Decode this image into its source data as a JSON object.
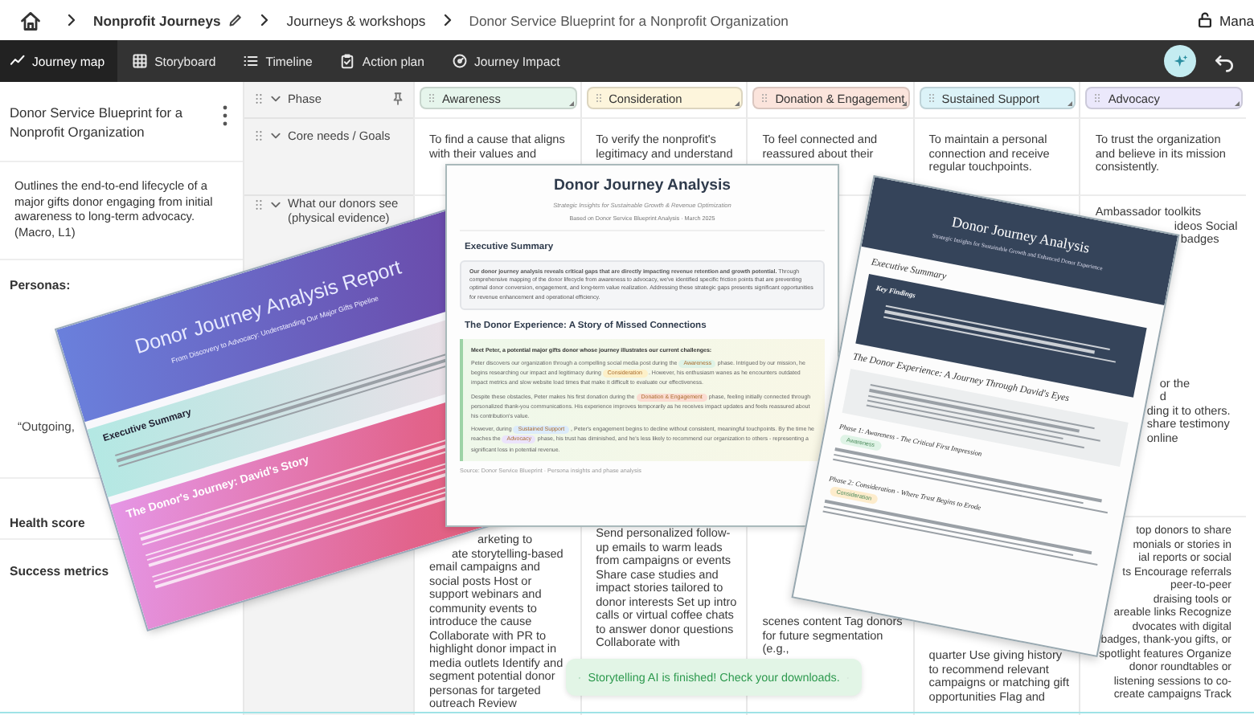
{
  "breadcrumbs": [
    "Nonprofit Journeys",
    "Journeys & workshops",
    "Donor Service Blueprint for a Nonprofit Organization"
  ],
  "account": {
    "label": "Mana"
  },
  "tabs": [
    {
      "label": "Journey map",
      "selected": true
    },
    {
      "label": "Storyboard",
      "selected": false
    },
    {
      "label": "Timeline",
      "selected": false
    },
    {
      "label": "Action plan",
      "selected": false
    },
    {
      "label": "Journey Impact",
      "selected": false
    }
  ],
  "journey": {
    "title": "Donor Service Blueprint for a Nonprofit Organization",
    "description": "Outlines the end-to-end lifecycle of a major gifts donor engaging from initial awareness to long-term advocacy. (Macro, L1)"
  },
  "sidebar_sections": [
    {
      "label": "Personas:",
      "quote": "“Outgoing,"
    },
    {
      "label": "Health score"
    },
    {
      "label": "Success metrics"
    }
  ],
  "row_labels": [
    "Phase",
    "Core needs / Goals",
    "What our donors see (physical evidence)"
  ],
  "phases": [
    {
      "label": "Awareness",
      "color": "#e6f5ec",
      "need": "To find a cause that aligns with their values and",
      "action_fragments": [
        "arketing to",
        "ate storytelling-based"
      ],
      "actions": "email campaigns and social posts Host or support webinars and community events to introduce the cause Collaborate with PR to highlight donor impact in media outlets Identify and segment potential donor personas for targeted outreach Review"
    },
    {
      "label": "Consideration",
      "color": "#fdf5dc",
      "need": "To verify the nonprofit's legitimacy and understand",
      "actions": "Send personalized follow-up emails to warm leads from campaigns or events Share case studies and impact stories tailored to donor interests Set up intro calls or virtual coffee chats to answer donor questions Collaborate with"
    },
    {
      "label": "Donation & Engagement",
      "color": "#fbe4dc",
      "need": "To feel connected and reassured about their",
      "actions": "scenes content Tag donors for future segmentation (e.g.,"
    },
    {
      "label": "Sustained Support",
      "color": "#dcf3f8",
      "need": "To maintain a personal connection and receive regular touchpoints.",
      "actions": "quarter Use giving history to recommend relevant campaigns or matching gift opportunities Flag and"
    },
    {
      "label": "Advocacy",
      "color": "#ebe8fb",
      "need": "To trust the organization and believe in its mission consistently.",
      "evidence_fragments": [
        "Ambassador toolkits",
        "ideos Social",
        "badges",
        "or the",
        "d",
        "ding it to others.",
        "share testimony",
        "online"
      ],
      "action_fragments": [
        "top donors to share",
        "monials or stories in",
        "ial reports or social",
        "ts Encourage referrals",
        "peer-to-peer",
        "draising tools or",
        "areable links Recognize",
        "dvocates with digital",
        "badges, thank-you gifts, or",
        "spotlight features Organize",
        "donor roundtables or",
        "listening sessions to co-",
        "create campaigns Track"
      ]
    }
  ],
  "report_gradient": {
    "title": "Donor Journey Analysis Report",
    "subtitle": "From Discovery to Advocacy: Understanding Our Major Gifts Pipeline",
    "summary_heading": "Executive Summary",
    "story_heading": "The Donor's Journey: David's Story"
  },
  "report_plain": {
    "title": "Donor Journey Analysis",
    "subtitle": "Strategic Insights for Sustainable Growth & Revenue Optimization",
    "based_on": "Based on Donor Service Blueprint Analysis · March 2025",
    "summary_heading": "Executive Summary",
    "summary": "**Our donor journey analysis reveals critical gaps that are directly impacting revenue retention and growth potential.** Through comprehensive mapping of the donor lifecycle from awareness to advocacy, we've identified specific friction points that are preventing optimal donor conversion, engagement, and long-term value realization. Addressing these strategic gaps presents significant opportunities for revenue enhancement and operational efficiency.",
    "story_heading": "The Donor Experience: A Story of Missed Connections",
    "story": [
      {
        "kind": "lead",
        "segments": [
          {
            "kind": "text",
            "text": "Meet Peter, a potential major gifts donor whose journey illustrates our current challenges:"
          }
        ]
      },
      {
        "kind": "body",
        "segments": [
          {
            "kind": "text",
            "text": "Peter discovers our organization through a compelling social media post during the"
          },
          {
            "kind": "tag",
            "text": "Awareness",
            "color": "#dff3e6"
          },
          {
            "kind": "text",
            "text": "phase. Intrigued by our mission, he begins researching our impact and legitimacy during"
          },
          {
            "kind": "tag",
            "text": "Consideration",
            "color": "#fdf0c8"
          },
          {
            "kind": "text",
            "text": ". However, his enthusiasm wanes as he encounters outdated impact metrics and slow website load times that make it difficult to evaluate our effectiveness."
          }
        ]
      },
      {
        "kind": "body",
        "segments": [
          {
            "kind": "text",
            "text": "Despite these obstacles, Peter makes his first donation during the"
          },
          {
            "kind": "tag",
            "text": "Donation & Engagement",
            "color": "#fbdcd2"
          },
          {
            "kind": "text",
            "text": "phase, feeling initially connected through personalized thank-you communications. His experience improves temporarily as he receives impact updates and feels reassured about his contribution's value."
          }
        ]
      },
      {
        "kind": "body",
        "segments": [
          {
            "kind": "text",
            "text": "However, during"
          },
          {
            "kind": "tag",
            "text": "Sustained Support",
            "color": "#dcebfb"
          },
          {
            "kind": "text",
            "text": ", Peter's engagement begins to decline without consistent, meaningful touchpoints. By the time he reaches the"
          },
          {
            "kind": "tag",
            "text": "Advocacy",
            "color": "#ebe3fb"
          },
          {
            "kind": "text",
            "text": "phase, his trust has diminished, and he's less likely to recommend our organization to others - representing a significant loss in potential revenue."
          }
        ]
      }
    ],
    "source": "Source: Donor Service Blueprint · Persona insights and phase analysis"
  },
  "report_dark": {
    "title": "Donor Journey Analysis",
    "subtitle": "Strategic Insights for Sustainable Growth and Enhanced Donor Experience",
    "summary_heading": "Executive Summary",
    "findings_heading": "Key Findings",
    "story_heading": "The Donor Experience: A Journey Through David's Eyes",
    "phases": [
      {
        "heading": "Phase 1: Awareness - The Critical First Impression",
        "tag": "Awareness",
        "color": "#dff3e6"
      },
      {
        "heading": "Phase 2: Consideration - Where Trust Begins to Erode",
        "tag": "Consideration",
        "color": "#fdeccc"
      }
    ]
  },
  "toast": {
    "message": "Storytelling AI is finished! Check your downloads."
  }
}
